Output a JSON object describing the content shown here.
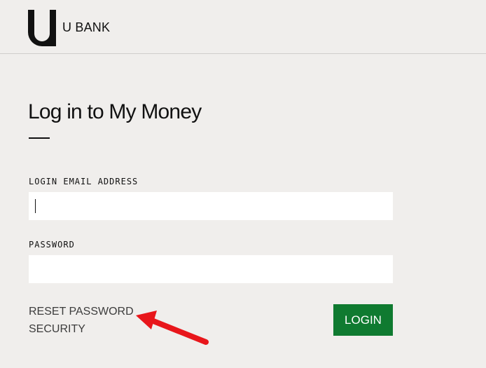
{
  "header": {
    "brand_name": "U BANK",
    "logo_icon": "u-bank-logo-icon"
  },
  "main": {
    "title": "Log in to My Money",
    "email": {
      "label": "LOGIN EMAIL ADDRESS",
      "value": "",
      "placeholder": ""
    },
    "password": {
      "label": "PASSWORD",
      "value": "",
      "placeholder": ""
    },
    "links": {
      "reset_password": "RESET PASSWORD",
      "security": "SECURITY"
    },
    "login_label": "LOGIN"
  },
  "annotation": {
    "arrow_icon": "red-arrow-icon",
    "arrow_color": "#e8161b"
  },
  "colors": {
    "background": "#f0eeec",
    "login_button": "#0f7a30",
    "input_background": "#ffffff"
  }
}
